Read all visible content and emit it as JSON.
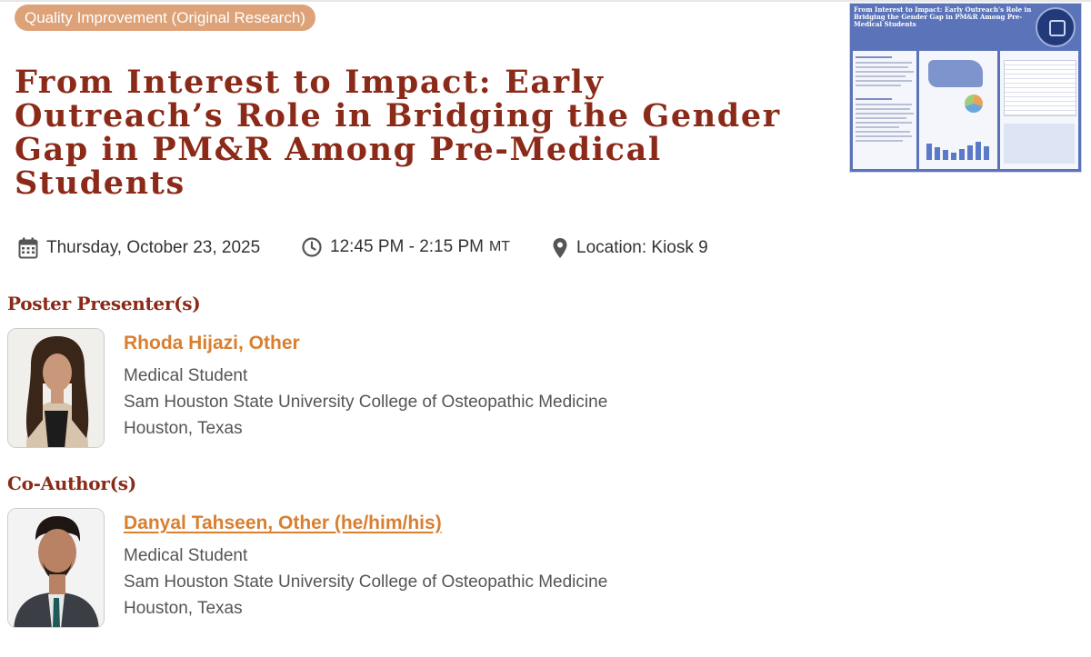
{
  "category": "Quality Improvement (Original Research)",
  "title": "From Interest to Impact: Early Outreach’s Role in Bridging the Gender Gap in PM&R Among Pre-Medical Students",
  "session": {
    "date": "Thursday, October 23, 2025",
    "time": "12:45 PM - 2:15 PM",
    "timezone": "MT",
    "location": "Location: Kiosk 9"
  },
  "icons": {
    "date": "calendar-icon",
    "time": "clock-icon",
    "location": "map-pin-icon"
  },
  "poster_thumbnail": {
    "title": "From Interest to Impact: Early Outreach's Role in Bridging the Gender Gap in PM&R Among Pre-Medical Students"
  },
  "presenters_heading": "Poster Presenter(s)",
  "presenters": [
    {
      "name": "Rhoda Hijazi, Other",
      "role": "Medical Student",
      "institution": "Sam Houston State University College of Osteopathic Medicine",
      "location": "Houston, Texas"
    }
  ],
  "coauthors_heading": "Co-Author(s)",
  "coauthors": [
    {
      "name": "Danyal Tahseen, Other (he/him/his)",
      "role": "Medical Student",
      "institution": "Sam Houston State University College of Osteopathic Medicine",
      "location": "Houston, Texas"
    }
  ],
  "colors": {
    "title": "#8b2a18",
    "badge": "#dda278",
    "name": "#d97f30"
  }
}
